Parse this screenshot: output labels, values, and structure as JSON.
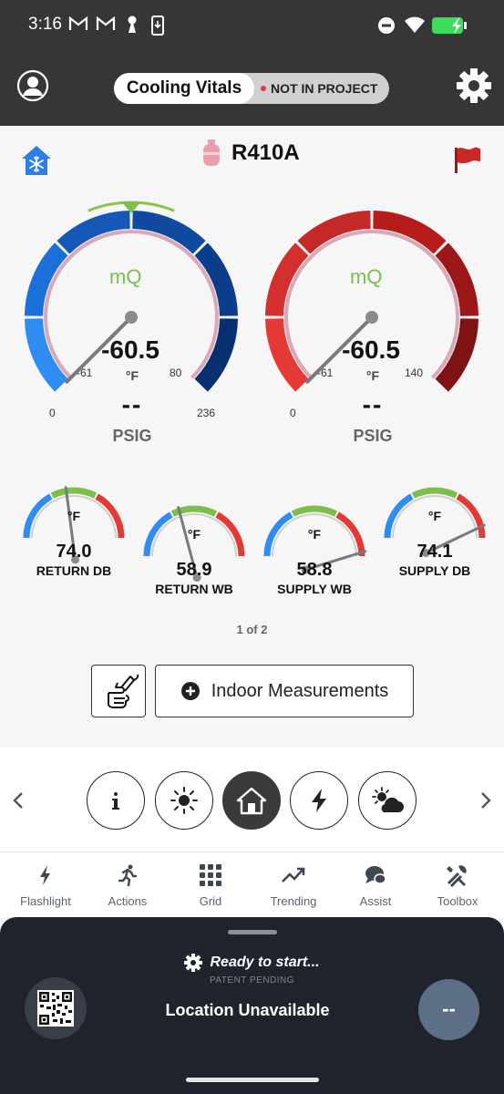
{
  "status_bar": {
    "time": "3:16",
    "icons": [
      "gmail-icon",
      "gmail-icon",
      "keyhole-icon",
      "download-phone-icon",
      "do-not-disturb-icon",
      "wifi-icon",
      "battery-charging-icon"
    ],
    "battery_color": "#3ddc5b"
  },
  "header": {
    "title": "Cooling Vitals",
    "project_status": "NOT IN PROJECT",
    "status_dot_color": "#e53935"
  },
  "refrigerant": {
    "label": "R410A"
  },
  "gauges": [
    {
      "id": "suction",
      "logo": "mQ",
      "value": "-60.5",
      "unit": "°F",
      "secondary": "--",
      "units_label": "PSIG",
      "outer_min": "0",
      "outer_max": "236",
      "inner_min": "-61",
      "inner_max": "80",
      "color_scheme": "blue",
      "target_marker": true
    },
    {
      "id": "liquid",
      "logo": "mQ",
      "value": "-60.5",
      "unit": "°F",
      "secondary": "--",
      "units_label": "PSIG",
      "outer_min": "0",
      "outer_max": "",
      "inner_min": "-61",
      "inner_max": "140",
      "color_scheme": "red",
      "target_marker": false
    }
  ],
  "mini_gauges": [
    {
      "unit": "°F",
      "value": "74.0",
      "label": "RETURN DB",
      "needle_fraction": 0.45
    },
    {
      "unit": "°F",
      "value": "58.9",
      "label": "RETURN WB",
      "needle_fraction": 0.4
    },
    {
      "unit": "°F",
      "value": "58.8",
      "label": "SUPPLY WB",
      "needle_fraction": 0.97
    },
    {
      "unit": "°F",
      "value": "74.1",
      "label": "SUPPLY DB",
      "needle_fraction": 0.92
    }
  ],
  "pager": {
    "text": "1 of 2"
  },
  "measurements_button": {
    "label": "Indoor Measurements"
  },
  "mode_buttons": [
    {
      "name": "info",
      "icon": "info-icon",
      "active": false
    },
    {
      "name": "sun",
      "icon": "sun-icon",
      "active": false
    },
    {
      "name": "home",
      "icon": "home-icon",
      "active": true
    },
    {
      "name": "electric",
      "icon": "lightning-icon",
      "active": false
    },
    {
      "name": "weather",
      "icon": "partly-cloudy-icon",
      "active": false
    }
  ],
  "tabs": [
    {
      "label": "Flashlight",
      "icon": "lightning-icon"
    },
    {
      "label": "Actions",
      "icon": "running-person-icon"
    },
    {
      "label": "Grid",
      "icon": "grid-icon"
    },
    {
      "label": "Trending",
      "icon": "trend-icon"
    },
    {
      "label": "Assist",
      "icon": "chat-bubbles-icon"
    },
    {
      "label": "Toolbox",
      "icon": "tools-icon"
    }
  ],
  "bottom_sheet": {
    "ready_text": "Ready to start...",
    "patent_text": "PATENT PENDING",
    "location_text": "Location Unavailable",
    "action_label": "--"
  }
}
